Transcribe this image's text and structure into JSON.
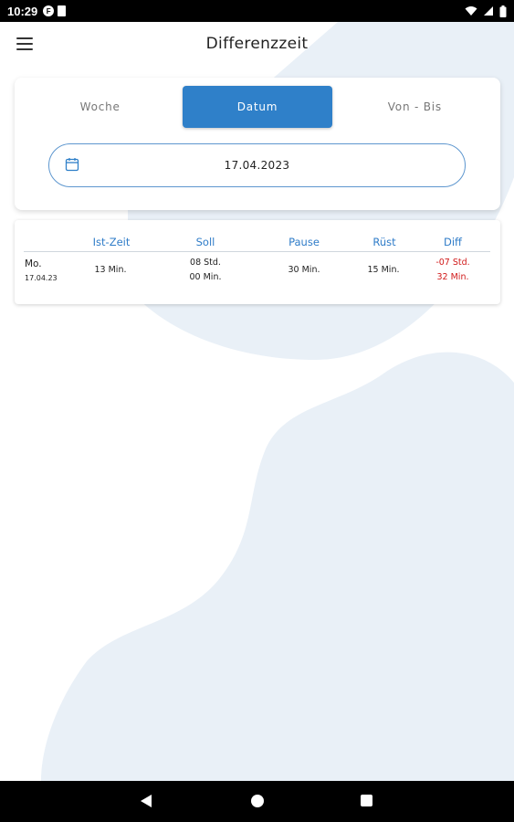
{
  "status_bar": {
    "time": "10:29",
    "left_icons": [
      "f-badge-icon",
      "sim-card-icon"
    ],
    "right_icons": [
      "wifi-icon",
      "cellular-icon",
      "battery-icon"
    ]
  },
  "app_bar": {
    "title": "Differenzzeit",
    "menu_icon": "hamburger-menu-icon"
  },
  "filter": {
    "tabs": [
      {
        "label": "Woche",
        "active": false
      },
      {
        "label": "Datum",
        "active": true
      },
      {
        "label": "Von - Bis",
        "active": false
      }
    ],
    "date_field": {
      "icon": "calendar-icon",
      "value": "17.04.2023"
    }
  },
  "table": {
    "headers": [
      "Ist-Zeit",
      "Soll",
      "Pause",
      "Rüst",
      "Diff"
    ],
    "rows": [
      {
        "day": "Mo.",
        "date": "17.04.23",
        "ist_zeit": "13 Min.",
        "soll_line1": "08 Std.",
        "soll_line2": "00 Min.",
        "pause": "30 Min.",
        "ruest": "15 Min.",
        "diff_line1": "-07 Std.",
        "diff_line2": "32 Min."
      }
    ]
  },
  "colors": {
    "accent": "#2f80c9",
    "header_text": "#2f7cc8",
    "negative": "#d11a1a",
    "background_blob": "#e9f0f7"
  },
  "nav_bar": {
    "icons": [
      "back-icon",
      "home-icon",
      "recents-icon"
    ]
  }
}
